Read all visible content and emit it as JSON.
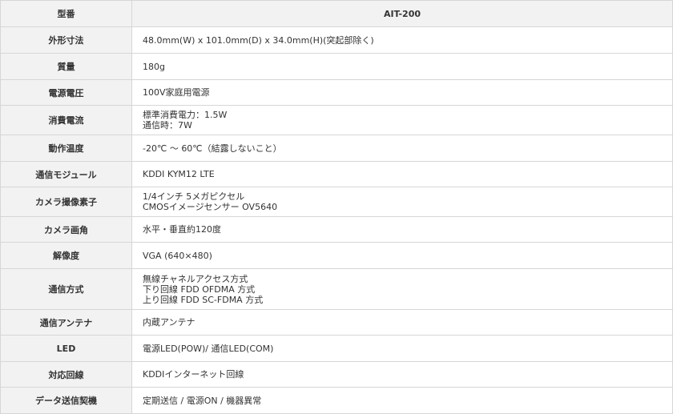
{
  "header": {
    "label": "型番",
    "model": "AIT-200"
  },
  "rows": [
    {
      "label": "外形寸法",
      "lines": [
        "48.0mm(W) x 101.0mm(D) x 34.0mm(H)(突起部除く)"
      ]
    },
    {
      "label": "質量",
      "lines": [
        "180g"
      ]
    },
    {
      "label": "電源電圧",
      "lines": [
        "100V家庭用電源"
      ]
    },
    {
      "label": "消費電流",
      "lines": [
        "標準消費電力：1.5W",
        "通信時：7W"
      ]
    },
    {
      "label": "動作温度",
      "lines": [
        "-20℃ 〜 60℃（結露しないこと）"
      ]
    },
    {
      "label": "通信モジュール",
      "lines": [
        "KDDI KYM12 LTE"
      ]
    },
    {
      "label": "カメラ撮像素子",
      "lines": [
        "1/4インチ 5メガピクセル",
        "CMOSイメージセンサー OV5640"
      ]
    },
    {
      "label": "カメラ画角",
      "lines": [
        "水平・垂直約120度"
      ]
    },
    {
      "label": "解像度",
      "lines": [
        "VGA (640×480)"
      ]
    },
    {
      "label": "通信方式",
      "lines": [
        "無線チャネルアクセス方式",
        "下り回線 FDD OFDMA 方式",
        "上り回線 FDD SC-FDMA 方式"
      ]
    },
    {
      "label": "通信アンテナ",
      "lines": [
        "内蔵アンテナ"
      ]
    },
    {
      "label": "LED",
      "lines": [
        "電源LED(POW)/ 通信LED(COM)"
      ]
    },
    {
      "label": "対応回線",
      "lines": [
        "KDDIインターネット回線"
      ]
    },
    {
      "label": "データ送信契機",
      "lines": [
        "定期送信 / 電源ON / 機器異常"
      ]
    }
  ]
}
